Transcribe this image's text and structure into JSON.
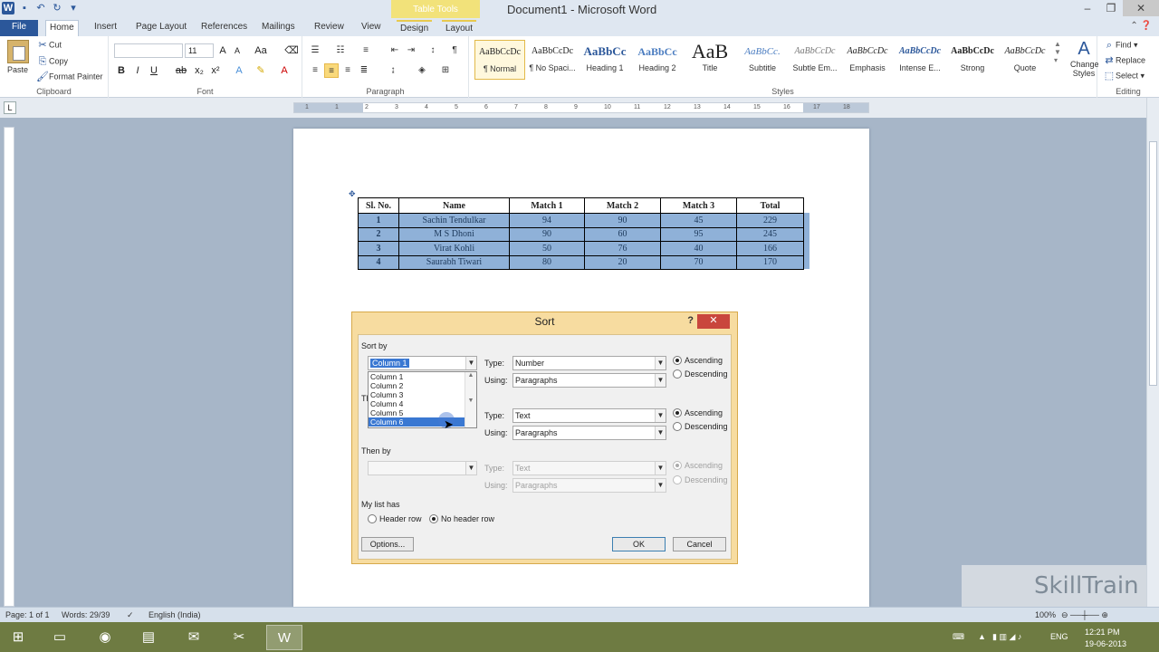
{
  "title_bar": {
    "doc_title": "Document1 - Microsoft Word",
    "context_header": "Table Tools",
    "qat_icons": [
      "word-icon",
      "save-icon",
      "undo-icon",
      "redo-icon",
      "customize-icon"
    ]
  },
  "tabs": [
    {
      "label": "File"
    },
    {
      "label": "Home"
    },
    {
      "label": "Insert"
    },
    {
      "label": "Page Layout"
    },
    {
      "label": "References"
    },
    {
      "label": "Mailings"
    },
    {
      "label": "Review"
    },
    {
      "label": "View"
    },
    {
      "label": "Design"
    },
    {
      "label": "Layout"
    }
  ],
  "ribbon": {
    "clipboard": {
      "paste": "Paste",
      "cut": "Cut",
      "copy": "Copy",
      "format_painter": "Format Painter",
      "label": "Clipboard"
    },
    "font": {
      "name": "",
      "size": "11",
      "label": "Font",
      "bold": "B",
      "italic": "I",
      "underline": "U"
    },
    "paragraph": {
      "label": "Paragraph"
    },
    "styles": {
      "label": "Styles",
      "items": [
        {
          "sample": "AaBbCcDc",
          "name": "¶ Normal"
        },
        {
          "sample": "AaBbCcDc",
          "name": "¶ No Spaci..."
        },
        {
          "sample": "AaBbCc",
          "name": "Heading 1"
        },
        {
          "sample": "AaBbCc",
          "name": "Heading 2"
        },
        {
          "sample": "AaB",
          "name": "Title"
        },
        {
          "sample": "AaBbCc.",
          "name": "Subtitle"
        },
        {
          "sample": "AaBbCcDc",
          "name": "Subtle Em..."
        },
        {
          "sample": "AaBbCcDc",
          "name": "Emphasis"
        },
        {
          "sample": "AaBbCcDc",
          "name": "Intense E..."
        },
        {
          "sample": "AaBbCcDc",
          "name": "Strong"
        },
        {
          "sample": "AaBbCcDc",
          "name": "Quote"
        }
      ],
      "change_styles": "Change Styles"
    },
    "editing": {
      "find": "Find",
      "replace": "Replace",
      "select": "Select",
      "label": "Editing"
    }
  },
  "ruler_ticks": [
    "1",
    "1",
    "2",
    "3",
    "4",
    "5",
    "6",
    "7",
    "8",
    "9",
    "10",
    "11",
    "12",
    "13",
    "14",
    "15",
    "16",
    "17",
    "18"
  ],
  "table": {
    "headers": [
      "Sl. No.",
      "Name",
      "Match 1",
      "Match 2",
      "Match 3",
      "Total"
    ],
    "rows": [
      [
        "1",
        "Sachin Tendulkar",
        "94",
        "90",
        "45",
        "229"
      ],
      [
        "2",
        "M S Dhoni",
        "90",
        "60",
        "95",
        "245"
      ],
      [
        "3",
        "Virat Kohli",
        "50",
        "76",
        "40",
        "166"
      ],
      [
        "4",
        "Saurabh Tiwari",
        "80",
        "20",
        "70",
        "170"
      ]
    ]
  },
  "sort_dialog": {
    "title": "Sort",
    "help": "?",
    "sort_by_label": "Sort by",
    "sort_by_value": "Column 1",
    "type_label": "Type:",
    "using_label": "Using:",
    "key1": {
      "type": "Number",
      "using": "Paragraphs",
      "ascending": "Ascending",
      "descending": "Descending"
    },
    "then_by_1_label": "Then by",
    "key2": {
      "type": "Text",
      "using": "Paragraphs",
      "ascending": "Ascending",
      "descending": "Descending"
    },
    "then_by_2_label": "Then by",
    "key3": {
      "type": "Text",
      "using": "Paragraphs",
      "ascending": "Ascending",
      "descending": "Descending"
    },
    "dropdown_options": [
      "Column 1",
      "Column 2",
      "Column 3",
      "Column 4",
      "Column 5",
      "Column 6"
    ],
    "highlighted_option": "Column 6",
    "my_list_has": "My list has",
    "header_row": "Header row",
    "no_header_row": "No header row",
    "options_btn": "Options...",
    "ok_btn": "OK",
    "cancel_btn": "Cancel"
  },
  "status_bar": {
    "page": "Page: 1 of 1",
    "words": "Words: 29/39",
    "language": "English (India)",
    "zoom": "100%"
  },
  "taskbar": {
    "lang": "ENG",
    "time": "12:21 PM",
    "date": "19-06-2013"
  },
  "watermark": "SkillTrain",
  "colors": {
    "accent": "#2b579a",
    "selection": "#8fb1d8",
    "dialog_frame": "#f7dca0",
    "taskbar": "#6e7b42"
  }
}
